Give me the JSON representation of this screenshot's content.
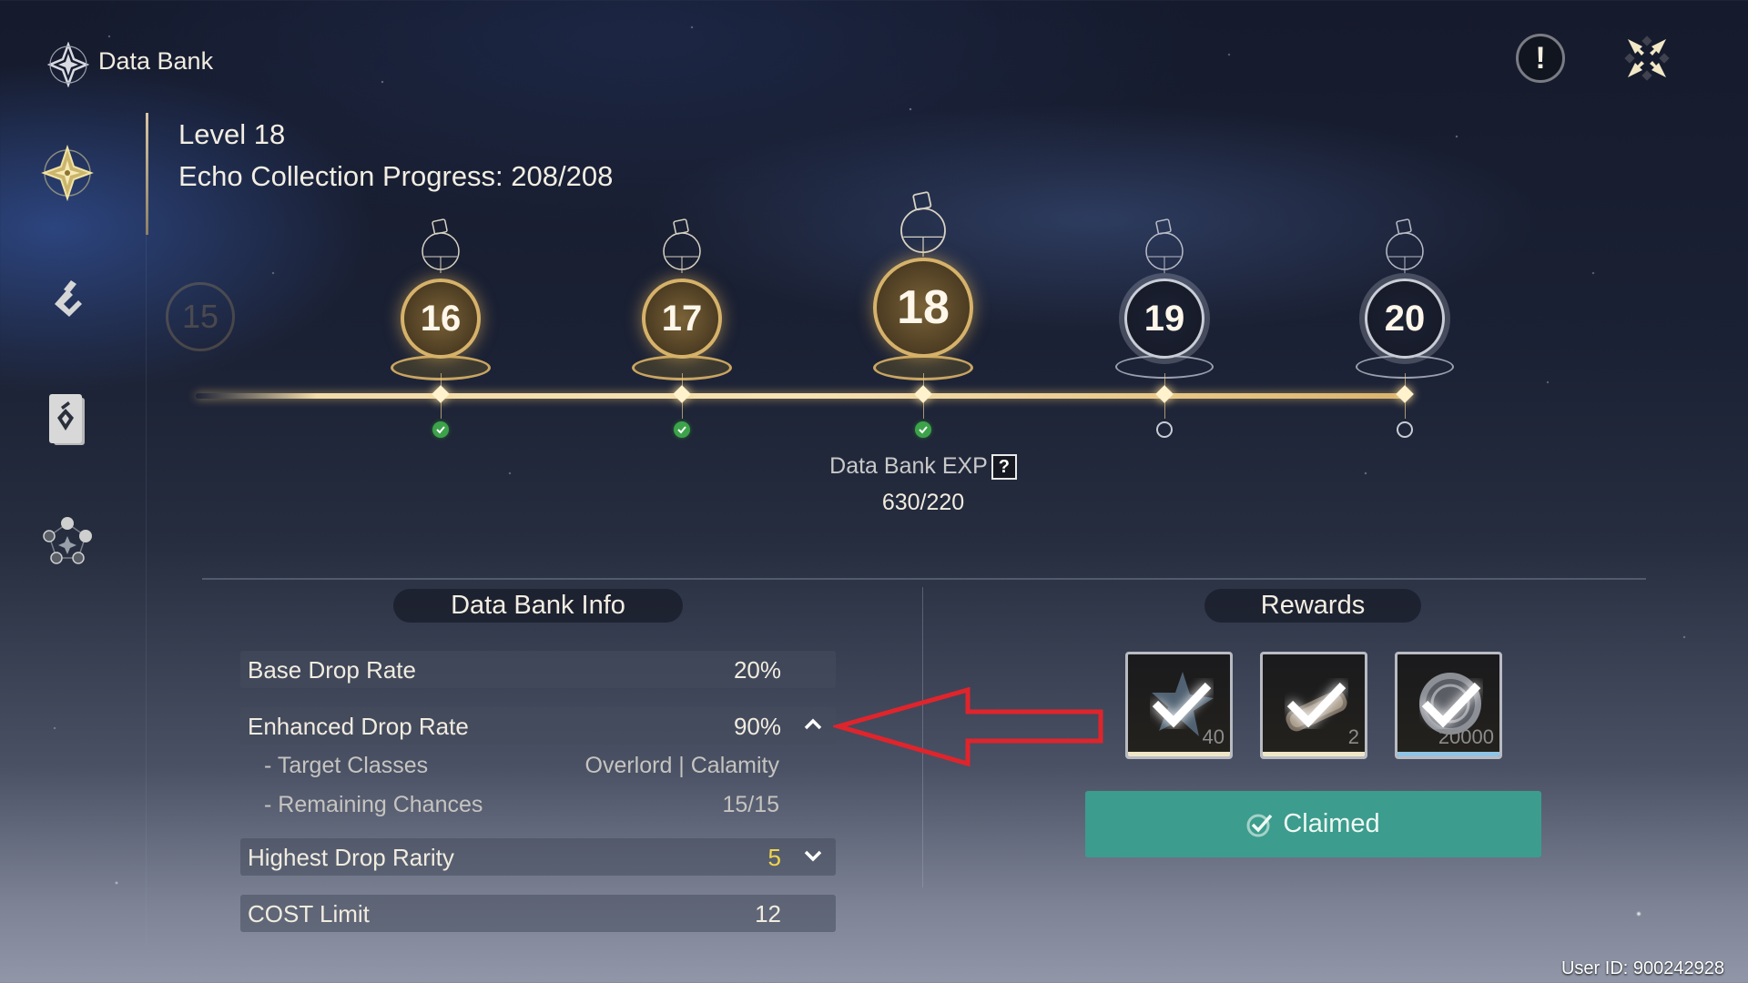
{
  "header": {
    "app_title": "Data Bank",
    "title_icon": "data-bank-emblem-icon",
    "info_icon": "exclamation",
    "close_icon": "close-star-icon"
  },
  "sidebar": {
    "items": [
      {
        "id": "data-bank",
        "icon": "data-bank-emblem-icon",
        "active": true
      },
      {
        "id": "echo-list",
        "icon": "echo-glyph-icon",
        "active": false
      },
      {
        "id": "echo-cards",
        "icon": "card-deck-icon",
        "active": false
      },
      {
        "id": "sonata",
        "icon": "constellation-icon",
        "active": false
      }
    ]
  },
  "status": {
    "level_text": "Level 18",
    "progress_text": "Echo Collection Progress: 208/208"
  },
  "timeline": {
    "faded_prev_level": "15",
    "levels": [
      {
        "level": "16",
        "state": "claimed"
      },
      {
        "level": "17",
        "state": "claimed"
      },
      {
        "level": "18",
        "state": "claimed",
        "current": true
      },
      {
        "level": "19",
        "state": "pending"
      },
      {
        "level": "20",
        "state": "pending"
      }
    ],
    "exp_label": "Data Bank EXP",
    "exp_help": "?",
    "exp_value": "630/220"
  },
  "info": {
    "title": "Data Bank Info",
    "rows": {
      "base_drop_rate": {
        "label": "Base Drop Rate",
        "value": "20%"
      },
      "enhanced_drop_rate": {
        "label": "Enhanced Drop Rate",
        "value": "90%",
        "expanded": true
      },
      "target_classes": {
        "label": "- Target Classes",
        "value": "Overlord | Calamity"
      },
      "remaining_chances": {
        "label": "- Remaining Chances",
        "value": "15/15"
      },
      "highest_drop_rarity": {
        "label": "Highest Drop Rarity",
        "value": "5",
        "expanded": false
      },
      "cost_limit": {
        "label": "COST Limit",
        "value": "12"
      }
    }
  },
  "rewards": {
    "title": "Rewards",
    "items": [
      {
        "name": "star-shard",
        "qty": "40",
        "claimed": true,
        "rarity_color": "#efe6c8"
      },
      {
        "name": "scroll-material",
        "qty": "2",
        "claimed": true,
        "rarity_color": "#efe6c8"
      },
      {
        "name": "shell-credit",
        "qty": "20000",
        "claimed": true,
        "rarity_color": "#8fc4e6"
      }
    ],
    "claim_button": "Claimed"
  },
  "annotation": {
    "type": "red-arrow",
    "points_to": "enhanced_drop_rate",
    "color": "#e0242c"
  },
  "footer": {
    "user_id": "User ID: 900242928"
  },
  "colors": {
    "gold": "#d6b26a",
    "claimed_green": "#3c9c8e",
    "rarity_yellow": "#f1d44a"
  }
}
